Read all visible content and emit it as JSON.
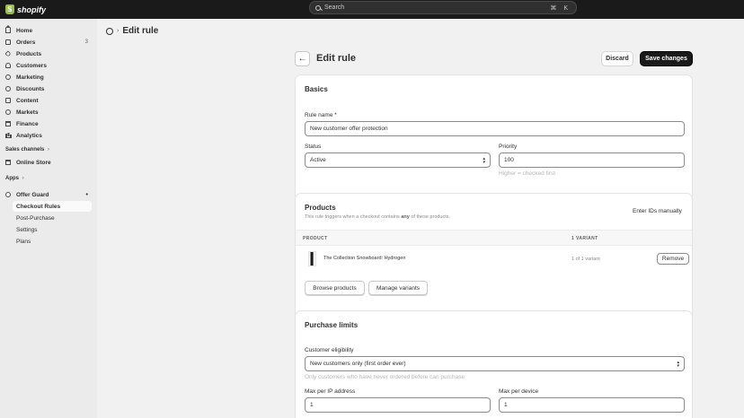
{
  "topbar": {
    "brand": "shopify",
    "search_label": "Search",
    "search_shortcut": "⌘ K"
  },
  "sidebar": {
    "items": [
      {
        "label": "Home",
        "icon": "home-icon"
      },
      {
        "label": "Orders",
        "icon": "orders-icon",
        "badge": "3"
      },
      {
        "label": "Products",
        "icon": "products-icon"
      },
      {
        "label": "Customers",
        "icon": "customers-icon"
      },
      {
        "label": "Marketing",
        "icon": "marketing-icon"
      },
      {
        "label": "Discounts",
        "icon": "discounts-icon"
      },
      {
        "label": "Content",
        "icon": "content-icon"
      },
      {
        "label": "Markets",
        "icon": "markets-icon"
      },
      {
        "label": "Finance",
        "icon": "finance-icon"
      },
      {
        "label": "Analytics",
        "icon": "analytics-icon"
      }
    ],
    "sales_channels_label": "Sales channels",
    "online_store_label": "Online Store",
    "apps_label": "Apps",
    "app_name": "Offer Guard",
    "app_sub_items": [
      "Checkout Rules",
      "Post-Purchase",
      "Settings",
      "Plans"
    ]
  },
  "breadcrumb": {
    "title": "Edit rule"
  },
  "page": {
    "title": "Edit rule",
    "discard_label": "Discard",
    "save_label": "Save changes"
  },
  "basics": {
    "title": "Basics",
    "rule_name_label": "Rule name *",
    "rule_name_value": "New customer offer protection",
    "status_label": "Status",
    "status_value": "Active",
    "priority_label": "Priority",
    "priority_value": "100",
    "priority_help": "Higher = checked first"
  },
  "products": {
    "title": "Products",
    "subtitle_pre": "This rule triggers when a checkout contains",
    "subtitle_em": "any",
    "subtitle_post": "of these products.",
    "enter_ids_label": "Enter IDs manually",
    "col_product": "PRODUCT",
    "col_variant": "1 VARIANT",
    "row_title": "The Collection Snowboard: Hydrogen",
    "row_variant": "1 of 1 variant",
    "remove_label": "Remove",
    "browse_label": "Browse products",
    "manage_label": "Manage variants"
  },
  "limits": {
    "title": "Purchase limits",
    "eligibility_label": "Customer eligibility",
    "eligibility_value": "New customers only (first order ever)",
    "eligibility_help": "Only customers who have never ordered before can purchase",
    "max_ip_label": "Max per IP address",
    "max_ip_value": "1",
    "max_device_label": "Max per device",
    "max_device_value": "1"
  }
}
